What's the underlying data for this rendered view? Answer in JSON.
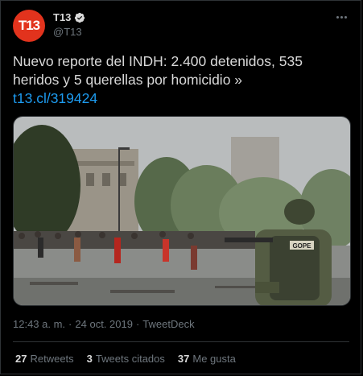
{
  "account": {
    "avatar_text": "T13",
    "display_name": "T13",
    "handle": "@T13",
    "verified": true
  },
  "tweet": {
    "text": "Nuevo reporte del INDH: 2.400 detenidos, 535 heridos y 5 querellas por homicidio »",
    "link": "t13.cl/319424",
    "media_caption_visible": "GOPE"
  },
  "meta": {
    "time": "12:43 a. m.",
    "separator1": "·",
    "date": "24 oct. 2019",
    "separator2": "·",
    "source": "TweetDeck"
  },
  "stats": {
    "retweets_count": "27",
    "retweets_label": "Retweets",
    "quotes_count": "3",
    "quotes_label": "Tweets citados",
    "likes_count": "37",
    "likes_label": "Me gusta"
  },
  "colors": {
    "background": "#000000",
    "brand_red": "#e2331d",
    "link_blue": "#1d9bf0",
    "muted": "#6e767d",
    "border": "#2f3336"
  },
  "icons": {
    "verified": "verified-badge-icon",
    "more": "more-dots-icon"
  }
}
